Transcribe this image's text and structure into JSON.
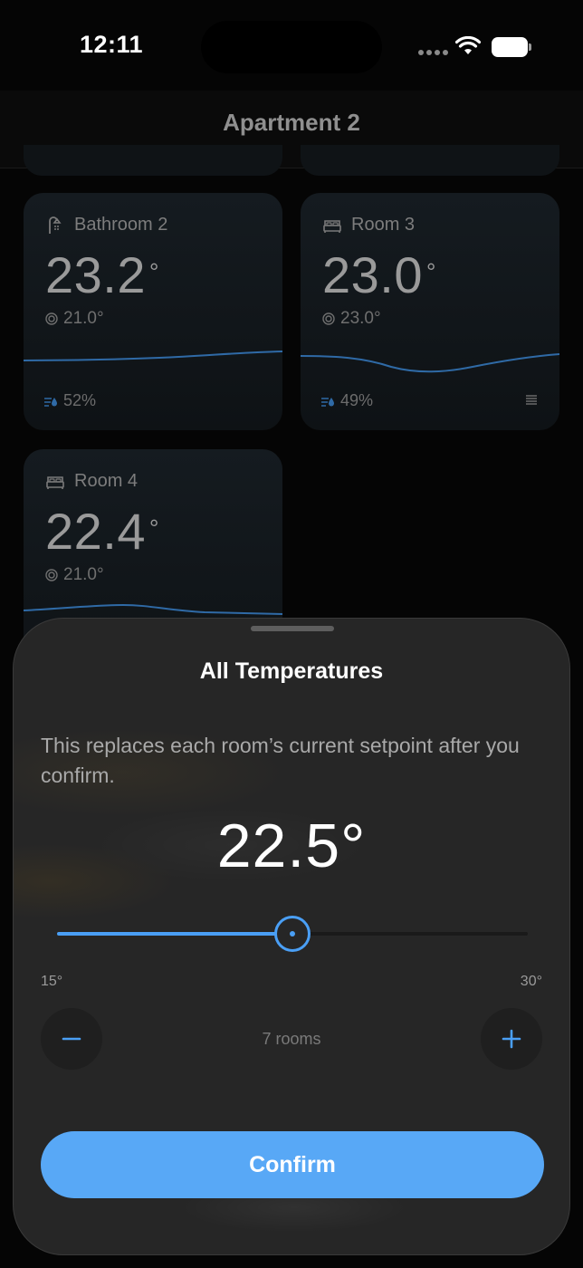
{
  "status_bar": {
    "time": "12:11"
  },
  "header": {
    "title": "Apartment 2"
  },
  "rooms": [
    {
      "name": "Bathroom 2",
      "icon": "shower-icon",
      "temperature": "23.2",
      "degree": "°",
      "setpoint": "21.0°",
      "humidity": "52%"
    },
    {
      "name": "Room 3",
      "icon": "bed-icon",
      "temperature": "23.0",
      "degree": "°",
      "setpoint": "23.0°",
      "humidity": "49%"
    },
    {
      "name": "Room 4",
      "icon": "bed-icon",
      "temperature": "22.4",
      "degree": "°",
      "setpoint": "21.0°"
    }
  ],
  "sheet": {
    "title": "All Temperatures",
    "description": "This replaces each room’s current setpoint after you confirm.",
    "value": "22.5°",
    "slider": {
      "min": 15,
      "max": 30,
      "value": 22.5
    },
    "min_label": "15°",
    "max_label": "30°",
    "rooms_count": "7 rooms",
    "confirm_label": "Confirm"
  },
  "colors": {
    "accent": "#58a8f6",
    "sheet_bg": "#262626",
    "background": "#050505"
  }
}
